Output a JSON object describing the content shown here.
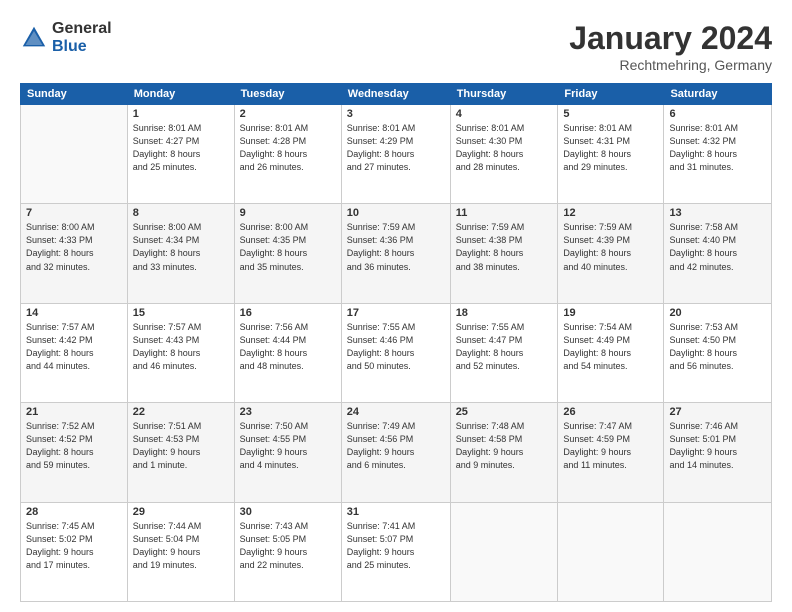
{
  "header": {
    "logo": {
      "general": "General",
      "blue": "Blue"
    },
    "title": "January 2024",
    "location": "Rechtmehring, Germany"
  },
  "days_of_week": [
    "Sunday",
    "Monday",
    "Tuesday",
    "Wednesday",
    "Thursday",
    "Friday",
    "Saturday"
  ],
  "weeks": [
    [
      {
        "day": "",
        "info": ""
      },
      {
        "day": "1",
        "info": "Sunrise: 8:01 AM\nSunset: 4:27 PM\nDaylight: 8 hours\nand 25 minutes."
      },
      {
        "day": "2",
        "info": "Sunrise: 8:01 AM\nSunset: 4:28 PM\nDaylight: 8 hours\nand 26 minutes."
      },
      {
        "day": "3",
        "info": "Sunrise: 8:01 AM\nSunset: 4:29 PM\nDaylight: 8 hours\nand 27 minutes."
      },
      {
        "day": "4",
        "info": "Sunrise: 8:01 AM\nSunset: 4:30 PM\nDaylight: 8 hours\nand 28 minutes."
      },
      {
        "day": "5",
        "info": "Sunrise: 8:01 AM\nSunset: 4:31 PM\nDaylight: 8 hours\nand 29 minutes."
      },
      {
        "day": "6",
        "info": "Sunrise: 8:01 AM\nSunset: 4:32 PM\nDaylight: 8 hours\nand 31 minutes."
      }
    ],
    [
      {
        "day": "7",
        "info": "Sunrise: 8:00 AM\nSunset: 4:33 PM\nDaylight: 8 hours\nand 32 minutes."
      },
      {
        "day": "8",
        "info": "Sunrise: 8:00 AM\nSunset: 4:34 PM\nDaylight: 8 hours\nand 33 minutes."
      },
      {
        "day": "9",
        "info": "Sunrise: 8:00 AM\nSunset: 4:35 PM\nDaylight: 8 hours\nand 35 minutes."
      },
      {
        "day": "10",
        "info": "Sunrise: 7:59 AM\nSunset: 4:36 PM\nDaylight: 8 hours\nand 36 minutes."
      },
      {
        "day": "11",
        "info": "Sunrise: 7:59 AM\nSunset: 4:38 PM\nDaylight: 8 hours\nand 38 minutes."
      },
      {
        "day": "12",
        "info": "Sunrise: 7:59 AM\nSunset: 4:39 PM\nDaylight: 8 hours\nand 40 minutes."
      },
      {
        "day": "13",
        "info": "Sunrise: 7:58 AM\nSunset: 4:40 PM\nDaylight: 8 hours\nand 42 minutes."
      }
    ],
    [
      {
        "day": "14",
        "info": "Sunrise: 7:57 AM\nSunset: 4:42 PM\nDaylight: 8 hours\nand 44 minutes."
      },
      {
        "day": "15",
        "info": "Sunrise: 7:57 AM\nSunset: 4:43 PM\nDaylight: 8 hours\nand 46 minutes."
      },
      {
        "day": "16",
        "info": "Sunrise: 7:56 AM\nSunset: 4:44 PM\nDaylight: 8 hours\nand 48 minutes."
      },
      {
        "day": "17",
        "info": "Sunrise: 7:55 AM\nSunset: 4:46 PM\nDaylight: 8 hours\nand 50 minutes."
      },
      {
        "day": "18",
        "info": "Sunrise: 7:55 AM\nSunset: 4:47 PM\nDaylight: 8 hours\nand 52 minutes."
      },
      {
        "day": "19",
        "info": "Sunrise: 7:54 AM\nSunset: 4:49 PM\nDaylight: 8 hours\nand 54 minutes."
      },
      {
        "day": "20",
        "info": "Sunrise: 7:53 AM\nSunset: 4:50 PM\nDaylight: 8 hours\nand 56 minutes."
      }
    ],
    [
      {
        "day": "21",
        "info": "Sunrise: 7:52 AM\nSunset: 4:52 PM\nDaylight: 8 hours\nand 59 minutes."
      },
      {
        "day": "22",
        "info": "Sunrise: 7:51 AM\nSunset: 4:53 PM\nDaylight: 9 hours\nand 1 minute."
      },
      {
        "day": "23",
        "info": "Sunrise: 7:50 AM\nSunset: 4:55 PM\nDaylight: 9 hours\nand 4 minutes."
      },
      {
        "day": "24",
        "info": "Sunrise: 7:49 AM\nSunset: 4:56 PM\nDaylight: 9 hours\nand 6 minutes."
      },
      {
        "day": "25",
        "info": "Sunrise: 7:48 AM\nSunset: 4:58 PM\nDaylight: 9 hours\nand 9 minutes."
      },
      {
        "day": "26",
        "info": "Sunrise: 7:47 AM\nSunset: 4:59 PM\nDaylight: 9 hours\nand 11 minutes."
      },
      {
        "day": "27",
        "info": "Sunrise: 7:46 AM\nSunset: 5:01 PM\nDaylight: 9 hours\nand 14 minutes."
      }
    ],
    [
      {
        "day": "28",
        "info": "Sunrise: 7:45 AM\nSunset: 5:02 PM\nDaylight: 9 hours\nand 17 minutes."
      },
      {
        "day": "29",
        "info": "Sunrise: 7:44 AM\nSunset: 5:04 PM\nDaylight: 9 hours\nand 19 minutes."
      },
      {
        "day": "30",
        "info": "Sunrise: 7:43 AM\nSunset: 5:05 PM\nDaylight: 9 hours\nand 22 minutes."
      },
      {
        "day": "31",
        "info": "Sunrise: 7:41 AM\nSunset: 5:07 PM\nDaylight: 9 hours\nand 25 minutes."
      },
      {
        "day": "",
        "info": ""
      },
      {
        "day": "",
        "info": ""
      },
      {
        "day": "",
        "info": ""
      }
    ]
  ]
}
